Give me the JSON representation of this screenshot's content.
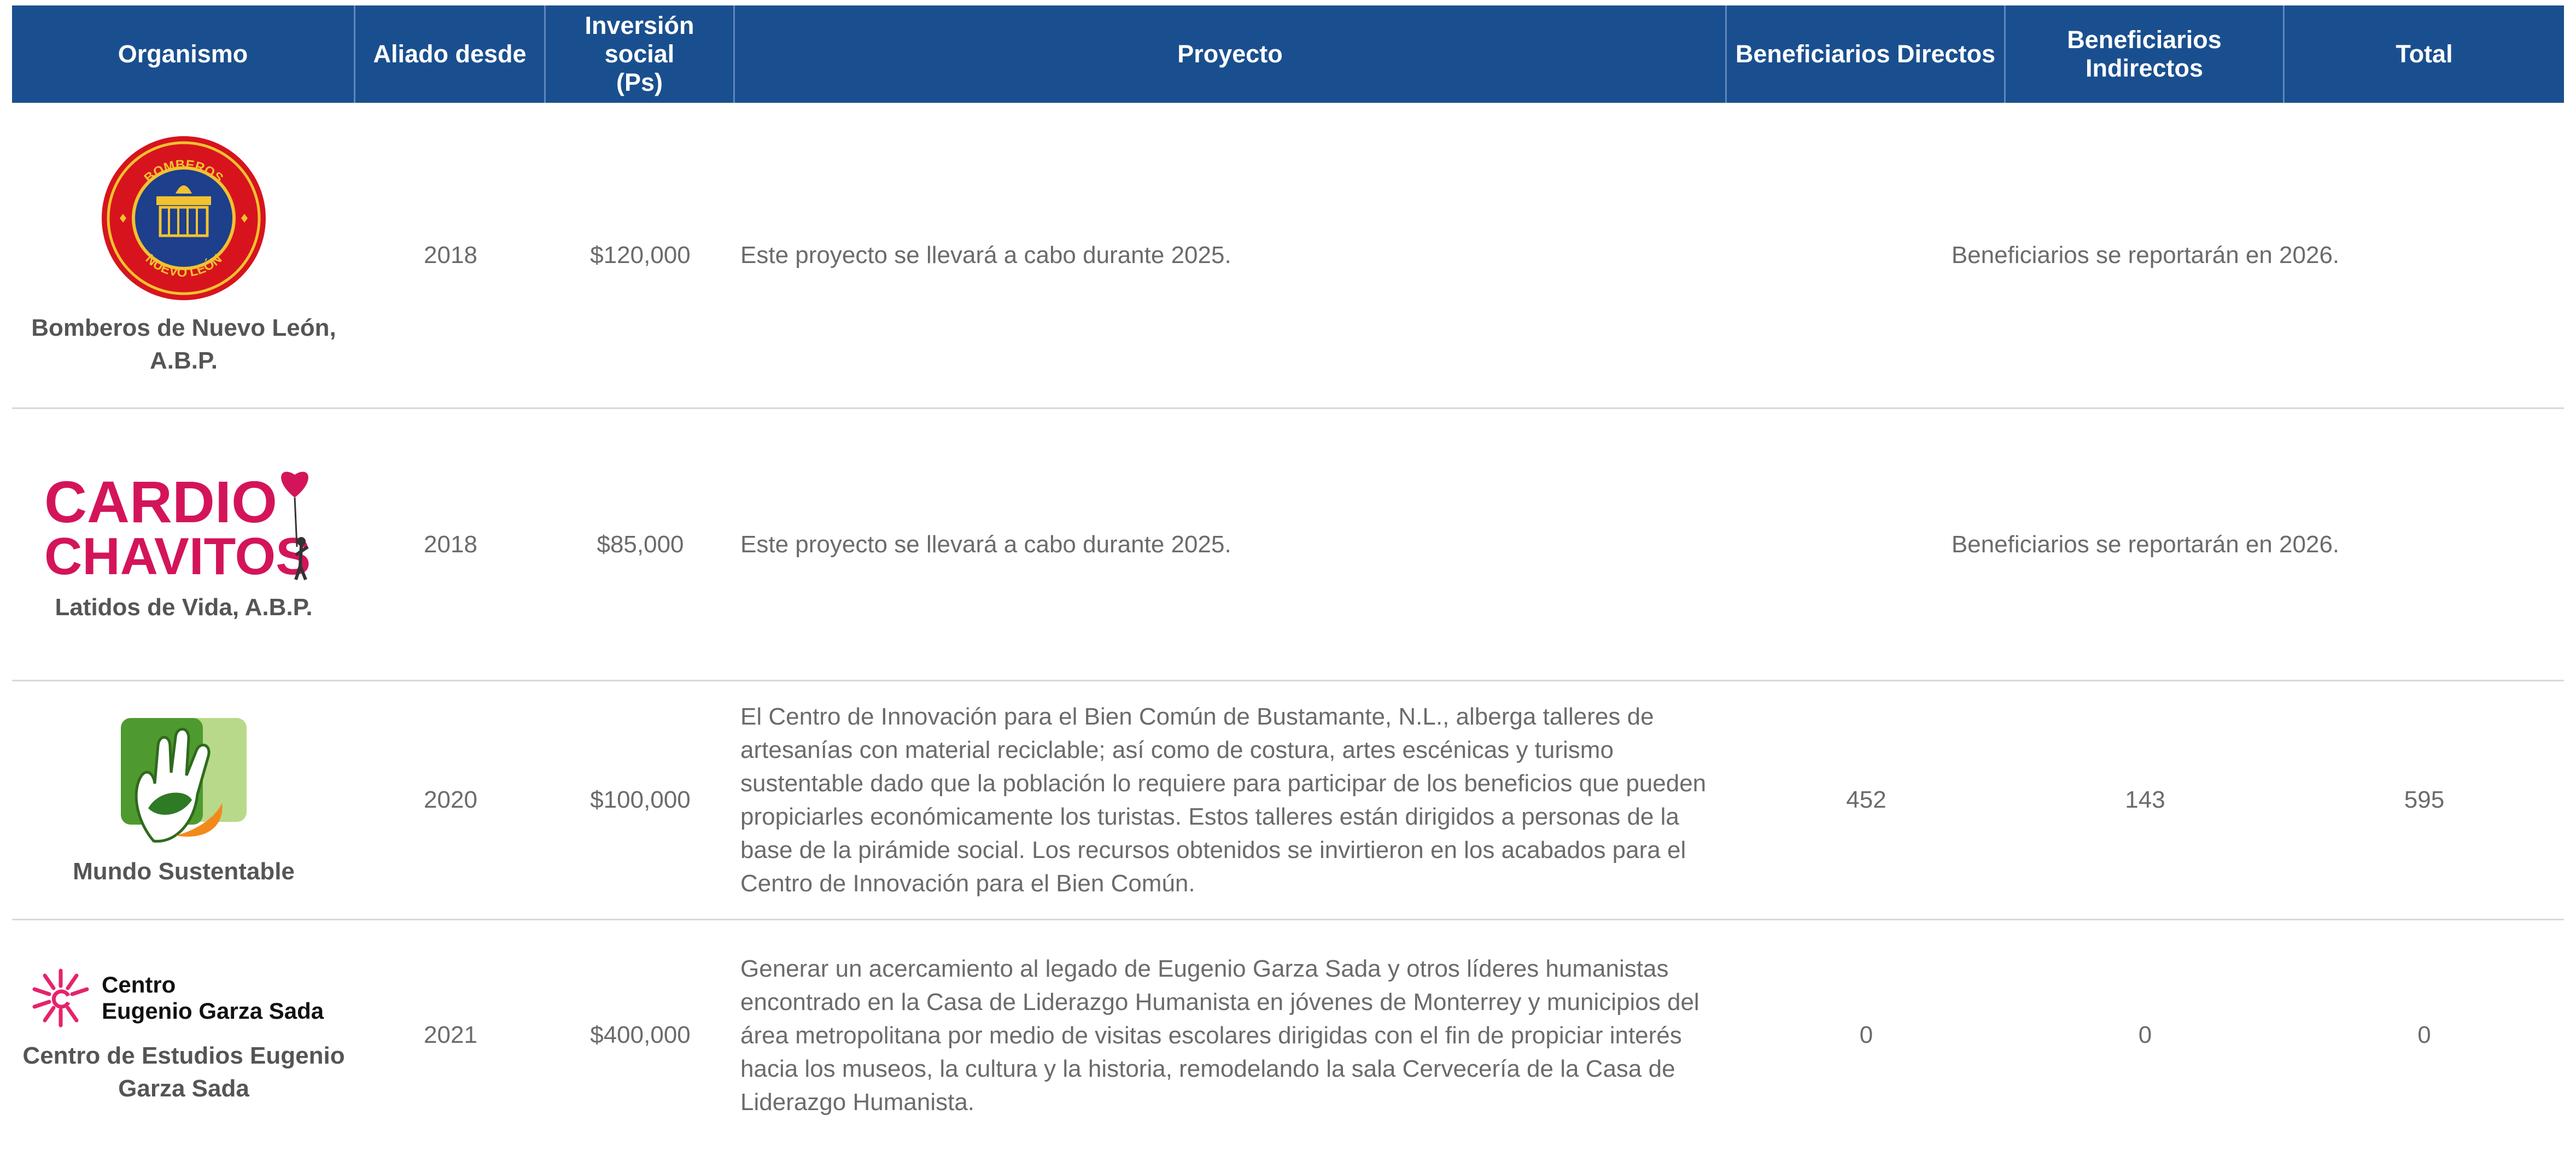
{
  "table": {
    "headers": {
      "organismo": "Organismo",
      "aliado": "Aliado desde",
      "inversion_l1": "Inversión",
      "inversion_l2": "social",
      "inversion_l3": "(Ps)",
      "proyecto": "Proyecto",
      "directos": "Beneficiarios Directos",
      "indirectos_l1": "Beneficiarios",
      "indirectos_l2": "Indirectos",
      "total": "Total"
    },
    "rows": [
      {
        "logo_icon": "bomberos-nuevo-leon-seal",
        "logo_text_top": "BOMBEROS",
        "logo_text_bottom": "NUEVO LEÓN",
        "org_l1": "Bomberos de Nuevo León,",
        "org_l2": "A.B.P.",
        "aliado": "2018",
        "inversion": "$120,000",
        "proyecto": "Este proyecto se llevará a cabo durante 2025.",
        "beneficiarios_nota": "Beneficiarios se reportarán en 2026."
      },
      {
        "logo_icon": "cardio-chavitos-logo",
        "logo_text_l1": "CARDIO",
        "logo_text_l2": "CHAVITOS",
        "org_l1": "Latidos de Vida, A.B.P.",
        "aliado": "2018",
        "inversion": "$85,000",
        "proyecto": "Este proyecto se llevará a cabo durante 2025.",
        "beneficiarios_nota": "Beneficiarios se reportarán en 2026."
      },
      {
        "logo_icon": "mundo-sustentable-hand-leaf-logo",
        "org_l1": "Mundo Sustentable",
        "aliado": "2020",
        "inversion": "$100,000",
        "proyecto_lines": [
          "El Centro de Innovación para el Bien Común de Bustamante, N.L., alberga talleres de",
          "artesanías con material reciclable; así como de costura, artes escénicas y turismo",
          "sustentable dado que la población lo requiere para participar de los beneficios que pueden",
          "propiciarles económicamente los turistas. Estos talleres están dirigidos a personas de la",
          "base de la pirámide social. Los recursos obtenidos se invirtieron en los acabados para el",
          "Centro de Innovación para el Bien Común."
        ],
        "directos": "452",
        "indirectos": "143",
        "total": "595"
      },
      {
        "logo_icon": "centro-eugenio-garza-sada-logo",
        "logo_text_l1": "Centro",
        "logo_text_l2": "Eugenio Garza Sada",
        "org_l1": "Centro de Estudios Eugenio",
        "org_l2": "Garza Sada",
        "aliado": "2021",
        "inversion": "$400,000",
        "proyecto_lines": [
          "Generar un acercamiento al legado de Eugenio Garza Sada y otros líderes humanistas",
          "encontrado en la Casa de Liderazgo Humanista en jóvenes de Monterrey y municipios del",
          "área metropolitana por medio de visitas escolares dirigidas con el fin de propiciar interés",
          "hacia los museos, la cultura y la historia, remodelando la sala Cervecería de la Casa de",
          "Liderazgo Humanista."
        ],
        "directos": "0",
        "indirectos": "0",
        "total": "0"
      }
    ]
  },
  "colors": {
    "header_bg": "#1a4f8f",
    "header_text": "#ffffff",
    "body_text": "#6b6b6b",
    "divider": "#d9d9d9",
    "cardio_pink": "#d4145a",
    "bomberos_red": "#d7141d",
    "bomberos_blue": "#1d3f8c",
    "mundo_green": "#6bb33f",
    "egs_pink": "#e6236c"
  }
}
